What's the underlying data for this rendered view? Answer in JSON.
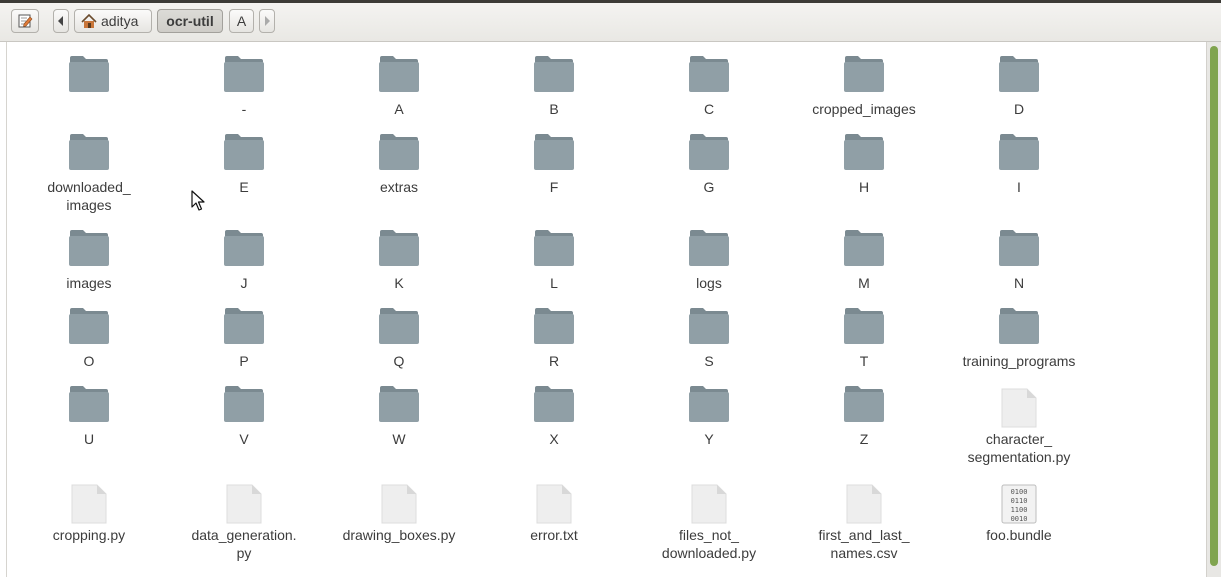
{
  "toolbar": {
    "edit_icon": "edit-pencil-icon",
    "back_icon": "left-arrow-icon",
    "forward_icon": "right-arrow-icon",
    "breadcrumbs": [
      "aditya",
      "ocr-util",
      "A"
    ]
  },
  "files": {
    "rows": [
      [
        {
          "name": "",
          "type": "folder"
        },
        {
          "name": "-",
          "type": "folder"
        },
        {
          "name": "A",
          "type": "folder"
        },
        {
          "name": "B",
          "type": "folder"
        },
        {
          "name": "C",
          "type": "folder"
        },
        {
          "name": "cropped_images",
          "type": "folder"
        },
        {
          "name": "D",
          "type": "folder"
        }
      ],
      [
        {
          "name": "downloaded_\nimages",
          "type": "folder"
        },
        {
          "name": "E",
          "type": "folder"
        },
        {
          "name": "extras",
          "type": "folder"
        },
        {
          "name": "F",
          "type": "folder"
        },
        {
          "name": "G",
          "type": "folder"
        },
        {
          "name": "H",
          "type": "folder"
        },
        {
          "name": "I",
          "type": "folder"
        }
      ],
      [
        {
          "name": "images",
          "type": "folder"
        },
        {
          "name": "J",
          "type": "folder"
        },
        {
          "name": "K",
          "type": "folder"
        },
        {
          "name": "L",
          "type": "folder"
        },
        {
          "name": "logs",
          "type": "folder"
        },
        {
          "name": "M",
          "type": "folder"
        },
        {
          "name": "N",
          "type": "folder"
        }
      ],
      [
        {
          "name": "O",
          "type": "folder"
        },
        {
          "name": "P",
          "type": "folder"
        },
        {
          "name": "Q",
          "type": "folder"
        },
        {
          "name": "R",
          "type": "folder"
        },
        {
          "name": "S",
          "type": "folder"
        },
        {
          "name": "T",
          "type": "folder"
        },
        {
          "name": "training_programs",
          "type": "folder"
        }
      ],
      [
        {
          "name": "U",
          "type": "folder"
        },
        {
          "name": "V",
          "type": "folder"
        },
        {
          "name": "W",
          "type": "folder"
        },
        {
          "name": "X",
          "type": "folder"
        },
        {
          "name": "Y",
          "type": "folder"
        },
        {
          "name": "Z",
          "type": "folder"
        },
        {
          "name": "character_\nsegmentation.py",
          "type": "file"
        }
      ],
      [
        {
          "name": "cropping.py",
          "type": "file"
        },
        {
          "name": "data_generation.\npy",
          "type": "file"
        },
        {
          "name": "drawing_boxes.py",
          "type": "file"
        },
        {
          "name": "error.txt",
          "type": "file"
        },
        {
          "name": "files_not_\ndownloaded.py",
          "type": "file"
        },
        {
          "name": "first_and_last_\nnames.csv",
          "type": "file"
        },
        {
          "name": "foo.bundle",
          "type": "binary"
        }
      ]
    ]
  },
  "colors": {
    "folder": "#909fa6",
    "folder_tab": "#7b8a91",
    "file": "#eeeeee",
    "scroll_thumb": "#80a44f"
  }
}
